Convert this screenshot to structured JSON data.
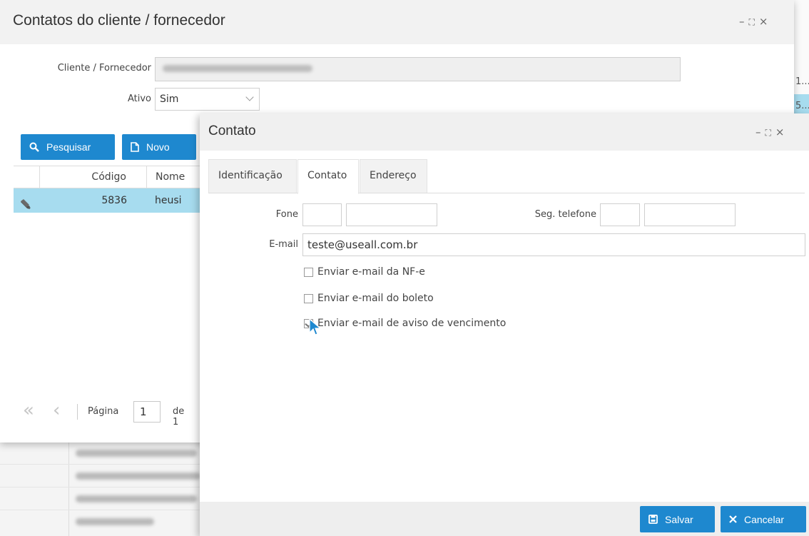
{
  "background": {
    "right_table_rows": [
      "1...",
      "5..."
    ]
  },
  "window_main": {
    "title": "Contatos do cliente / fornecedor",
    "controls": [
      "–",
      "⛶",
      "×"
    ],
    "fields": {
      "cliente_label": "Cliente / Fornecedor",
      "ativo_label": "Ativo",
      "ativo_value": "Sim"
    },
    "buttons": {
      "search": "Pesquisar",
      "new": "Novo"
    },
    "grid": {
      "columns": [
        "Código",
        "Nome"
      ],
      "rows": [
        {
          "code": "5836",
          "name": "heusi"
        }
      ]
    },
    "pager": {
      "page_label": "Página",
      "page_value": "1",
      "of_label": "de 1"
    }
  },
  "window_contact": {
    "title": "Contato",
    "tabs": [
      "Identificação",
      "Contato",
      "Endereço"
    ],
    "active_tab": "Contato",
    "fields": {
      "phone_label": "Fone",
      "second_phone_label": "Seg. telefone",
      "email_label": "E-mail",
      "email_value": "teste@useall.com.br"
    },
    "checkboxes": [
      {
        "label": "Enviar e-mail da NF-e",
        "checked": false
      },
      {
        "label": "Enviar e-mail do boleto",
        "checked": false
      },
      {
        "label": "Enviar e-mail de aviso de vencimento",
        "checked": true
      }
    ],
    "buttons": {
      "save": "Salvar",
      "cancel": "Cancelar"
    }
  },
  "colors": {
    "accent": "#1e88cf",
    "selected_row": "#a7dcef"
  }
}
